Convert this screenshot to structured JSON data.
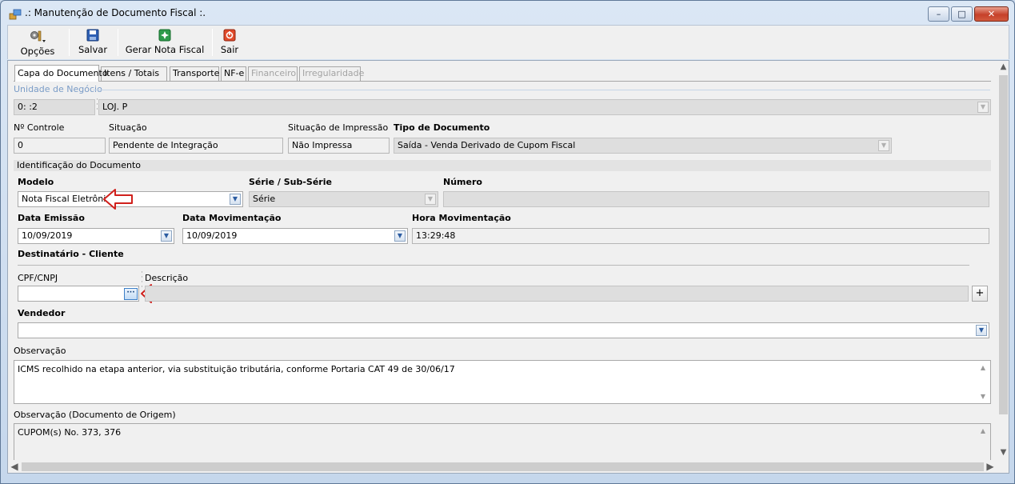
{
  "window": {
    "title": ".: Manutenção de Documento Fiscal :."
  },
  "window_buttons": {
    "minimize": "–",
    "maximize": "□",
    "close": "✕"
  },
  "toolbar": {
    "options_label": "Opções",
    "save_label": "Salvar",
    "generate_label": "Gerar Nota Fiscal",
    "exit_label": "Sair"
  },
  "tabs": [
    {
      "label": "Capa do Documento"
    },
    {
      "label": "Itens / Totais"
    },
    {
      "label": "Transporte"
    },
    {
      "label": "NF-e"
    },
    {
      "label": "Financeiro"
    },
    {
      "label": "Irregularidade"
    }
  ],
  "business_unit": {
    "group_label": "Unidade de Negócio",
    "code": "0:        :2",
    "name": "LOJ.                                                    P"
  },
  "header_fields": {
    "control_label": "Nº Controle",
    "control_value": "0",
    "status_label": "Situação",
    "status_value": "Pendente de Integração",
    "print_status_label": "Situação de Impressão",
    "print_status_value": "Não Impressa",
    "doc_type_label": "Tipo de Documento",
    "doc_type_value": "Saída - Venda Derivado de Cupom Fiscal"
  },
  "identification": {
    "section_label": "Identificação do Documento",
    "model_label": "Modelo",
    "model_value": "Nota Fiscal Eletrônica",
    "series_label": "Série / Sub-Série",
    "series_value": "Série",
    "number_label": "Número",
    "number_value": "",
    "issue_date_label": "Data Emissão",
    "issue_date_value": "10/09/2019",
    "move_date_label": "Data Movimentação",
    "move_date_value": "10/09/2019",
    "move_time_label": "Hora Movimentação",
    "move_time_value": "13:29:48"
  },
  "recipient": {
    "section_label": "Destinatário - Cliente",
    "cpf_label": "CPF/CNPJ",
    "cpf_value": "",
    "description_label": "Descrição",
    "description_value": "",
    "add_label": "+",
    "lookup_label": "···"
  },
  "seller": {
    "label": "Vendedor",
    "value": ""
  },
  "observation": {
    "label": "Observação",
    "value": "ICMS recolhido na etapa anterior, via substituição tributária, conforme Portaria CAT 49 de 30/06/17"
  },
  "origin_observation": {
    "label": "Observação (Documento de Origem)",
    "value": "CUPOM(s) No. 373, 376"
  },
  "colors": {
    "arrow": "#d0201c",
    "group_label": "#7a9cc7"
  }
}
